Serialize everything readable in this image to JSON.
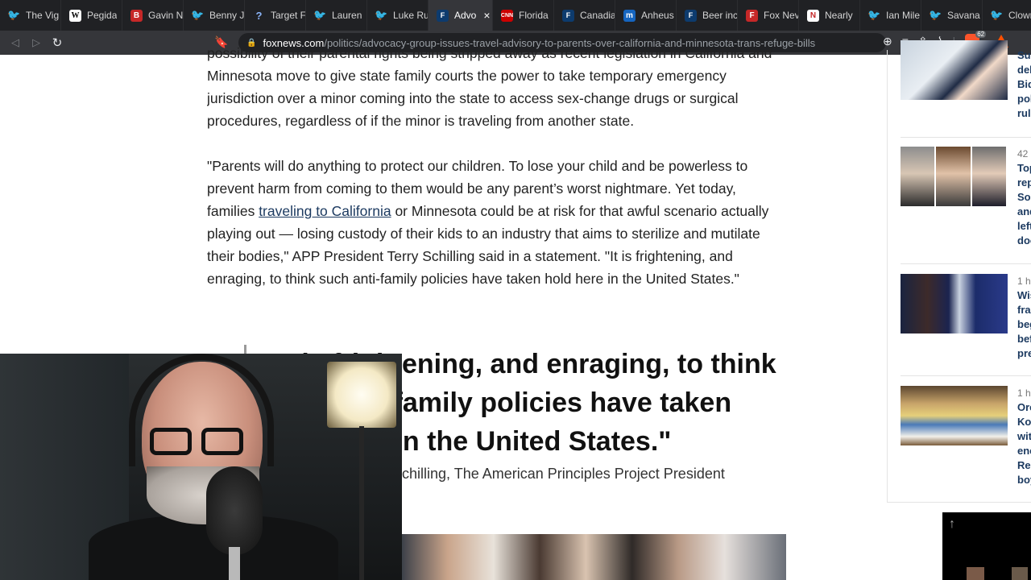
{
  "browser": {
    "tabs": [
      {
        "label": "The Vig",
        "icon": "twitter-icon",
        "fav": "twitter",
        "glyph": "🐦"
      },
      {
        "label": "Pegida",
        "icon": "wikipedia-icon",
        "fav": "wiki",
        "glyph": "W"
      },
      {
        "label": "Gavin N",
        "icon": "bitchute-icon",
        "fav": "b",
        "glyph": "B"
      },
      {
        "label": "Benny J",
        "icon": "twitter-icon",
        "fav": "twitter",
        "glyph": "🐦"
      },
      {
        "label": "Target F",
        "icon": "question-icon",
        "fav": "target",
        "glyph": "?"
      },
      {
        "label": "Lauren",
        "icon": "twitter-icon",
        "fav": "twitter",
        "glyph": "🐦"
      },
      {
        "label": "Luke Ru",
        "icon": "twitter-icon",
        "fav": "twitter",
        "glyph": "🐦"
      },
      {
        "label": "Advo",
        "icon": "foxnews-icon",
        "fav": "fox",
        "glyph": "F",
        "active": true
      },
      {
        "label": "Florida",
        "icon": "cnn-icon",
        "fav": "cnn",
        "glyph": "CNN"
      },
      {
        "label": "Canadia",
        "icon": "foxnews-icon",
        "fav": "fox",
        "glyph": "F"
      },
      {
        "label": "Anheus",
        "icon": "m-icon",
        "fav": "m",
        "glyph": "m"
      },
      {
        "label": "Beer inc",
        "icon": "foxnews-icon",
        "fav": "fox",
        "glyph": "F"
      },
      {
        "label": "Fox Nev",
        "icon": "f-icon",
        "fav": "f",
        "glyph": "F"
      },
      {
        "label": "Nearly",
        "icon": "nearly-icon",
        "fav": "nearly",
        "glyph": "N"
      },
      {
        "label": "Ian Mile",
        "icon": "twitter-icon",
        "fav": "twitter",
        "glyph": "🐦"
      },
      {
        "label": "Savana",
        "icon": "twitter-icon",
        "fav": "twitter",
        "glyph": "🐦"
      },
      {
        "label": "Clown V",
        "icon": "twitter-icon",
        "fav": "twitter",
        "glyph": "🐦"
      }
    ],
    "url_domain": "foxnews.com",
    "url_path": "/politics/advocacy-group-issues-travel-advisory-to-parents-over-california-and-minnesota-trans-refuge-bills",
    "brave_badge": "62"
  },
  "article": {
    "para1": "possibility of their parental rights being stripped away as recent legislation in California and Minnesota move to give state family courts the power to take temporary emergency jurisdiction over a minor coming into the state to access sex-change drugs or surgical procedures, regardless of if the minor is traveling from another state.",
    "para2_before": "\"Parents will do anything to protect our children. To lose your child and be powerless to prevent harm from coming to them would be any parent’s worst nightmare. Yet today, families ",
    "para2_link": "traveling to California",
    "para2_after": " or Minnesota could be at risk for that awful scenario actually playing out — losing custody of their kids to an industry that aims to sterilize and mutilate their bodies,\" APP President Terry Schilling said in a statement. \"It is frightening, and enraging, to think such anti-family policies have taken hold here in the United States.\"",
    "pullquote": "\"It is frightening, and enraging, to think such anti-family policies have taken hold here in the United States.\"",
    "attribution": "ry Schilling, The American Principles Project President"
  },
  "sidebar": {
    "items": [
      {
        "time": "",
        "lines": [
          "Sup",
          "del",
          "Bid",
          "pol",
          "ruli"
        ]
      },
      {
        "time": "42 r",
        "lines": [
          "Top",
          "rep",
          "Sor",
          "and",
          "left",
          "doc"
        ]
      },
      {
        "time": "1 ho",
        "lines": [
          "Wis",
          "frau",
          "beg",
          "bef",
          "pre"
        ]
      },
      {
        "time": "1 ho",
        "lines": [
          "Ore",
          "Kot",
          "with",
          "enc",
          "Rep",
          "boy"
        ]
      }
    ]
  },
  "scroll_top_label": "↑"
}
